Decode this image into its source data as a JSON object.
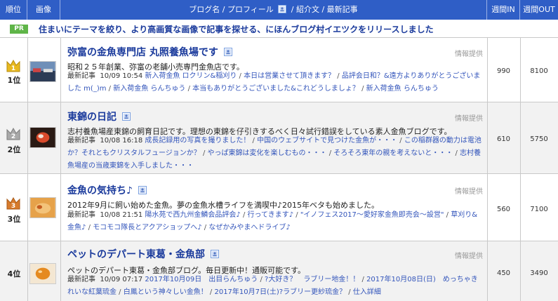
{
  "header": {
    "rank": "順位",
    "image": "画像",
    "main": "ブログ名 / プロフィール",
    "main2": "/ 紹介文 / 最新記事",
    "in": "週間IN",
    "out": "週間OUT"
  },
  "pr": {
    "badge": "PR",
    "text": "住まいにテーマを絞り、より高画質な画像で記事を探せる、にほんブログ村イエツクをリリースしました"
  },
  "colors": {
    "header_bg": "#2f5ec6",
    "link": "#1a3a9c",
    "gold": "#e8b920",
    "silver": "#a9a9a9",
    "bronze": "#d77b2c"
  },
  "entries": [
    {
      "rank": "1位",
      "title": "弥富の金魚専門店 丸照養魚場です",
      "info": "情報提供",
      "desc": "昭和２５年創業、弥富の老舗小売専門金魚店です。",
      "latest_label": "最新記事",
      "date": "10/09 10:54",
      "articles": [
        "新入荷金魚 ロクリン&稲刈り",
        "本日は営業させて頂きます？",
        "品評会日和？&遠方よりありがとうございました m(_)m",
        "新入荷金魚 らんちゅう",
        "本当もありがとうございました&これどうしましょ？",
        "新入荷金魚 らんちゅう"
      ],
      "in": "990",
      "out": "8100"
    },
    {
      "rank": "2位",
      "title": "東錦の日記",
      "info": "情報提供",
      "desc": "志村養魚場産東錦の飼育日記です。理想の東錦を仔引きするべく日々試行錯誤をしている素人金魚ブログです。",
      "latest_label": "最新記事",
      "date": "10/08 16:18",
      "articles": [
        "成長記録用の写真を撮りました！",
        "中国のウェブサイトで見つけた金魚が・・・",
        "この稲群器の動力は電池か？それともクリスタルフュージョンか？",
        "やっぱ東錦は変化を楽しむもの・・・",
        "そろそろ東年の親を考えないと・・・",
        "志村養魚場産の当歳東錦を入手しました・・・"
      ],
      "in": "610",
      "out": "5750"
    },
    {
      "rank": "3位",
      "title": "金魚の気持ち♪",
      "info": "情報提供",
      "desc": "2012年9月に飼い始めた金魚。夢の金魚水槽ライフを満喫中♪2015年ベタも始めました。",
      "latest_label": "最新記事",
      "date": "10/08 21:51",
      "articles": [
        "陽水苑で西九州金鱗会品評会♪",
        "行ってきます♪",
        "\"イノフェス2017〜愛好家金魚即売会〜設営\"",
        "草刈り&金魚♪",
        "モコモコ隊長とアクアショップへ♪",
        "なぜかみやまへドライブ♪"
      ],
      "in": "560",
      "out": "7100"
    },
    {
      "rank": "4位",
      "title": "ペットのデパート東葛・金魚部",
      "info": "情報提供",
      "desc": "ペットのデパート東葛・金魚部ブログ。毎日更新中！通販可能です。",
      "latest_label": "最新記事",
      "date": "10/09 07:17",
      "articles": [
        "2017年10月09日　出目らんちゅう",
        "?大好き？　ラブリー地金！！",
        "2017年10月08日(日)　めっちゃきれいな紅葉琉金",
        "白鳳という神々しい金魚！",
        "2017年10月7日(土)?ラブリー更紗琉金？",
        "仕入詳細"
      ],
      "in": "450",
      "out": "3490"
    }
  ]
}
